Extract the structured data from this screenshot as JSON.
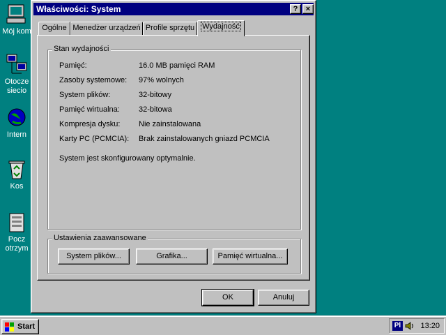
{
  "desktop": {
    "icons": [
      {
        "label": "Mój kom"
      },
      {
        "label": "Otocze",
        "label2": "siecio"
      },
      {
        "label": "Intern"
      },
      {
        "label": "Kos"
      },
      {
        "label": "Pocz",
        "label2": "otrzym"
      }
    ]
  },
  "dialog": {
    "title": "Właściwości: System",
    "help_btn": "?",
    "close_btn": "×",
    "tabs": [
      "Ogólne",
      "Menedżer urządzeń",
      "Profile sprzętu",
      "Wydajność"
    ],
    "active_tab": 3,
    "status_group": {
      "legend": "Stan wydajności",
      "rows": [
        {
          "key": "Pamięć:",
          "value": "16.0 MB pamięci RAM"
        },
        {
          "key": "Zasoby systemowe:",
          "value": "97% wolnych"
        },
        {
          "key": "System plików:",
          "value": "32-bitowy"
        },
        {
          "key": "Pamięć wirtualna:",
          "value": "32-bitowa"
        },
        {
          "key": "Kompresja dysku:",
          "value": "Nie zainstalowana"
        },
        {
          "key": "Karty PC (PCMCIA):",
          "value": "Brak zainstalowanych gniazd PCMCIA"
        }
      ],
      "message": "System jest skonfigurowany optymalnie."
    },
    "advanced_group": {
      "legend": "Ustawienia zaawansowane",
      "buttons": [
        "System plików...",
        "Grafika...",
        "Pamięć wirtualna..."
      ]
    },
    "ok_label": "OK",
    "cancel_label": "Anuluj"
  },
  "taskbar": {
    "start_label": "Start",
    "lang": "Pl",
    "clock": "13:20"
  },
  "colors": {
    "desktop": "#008080",
    "titlebar": "#000080",
    "face": "#c0c0c0"
  }
}
